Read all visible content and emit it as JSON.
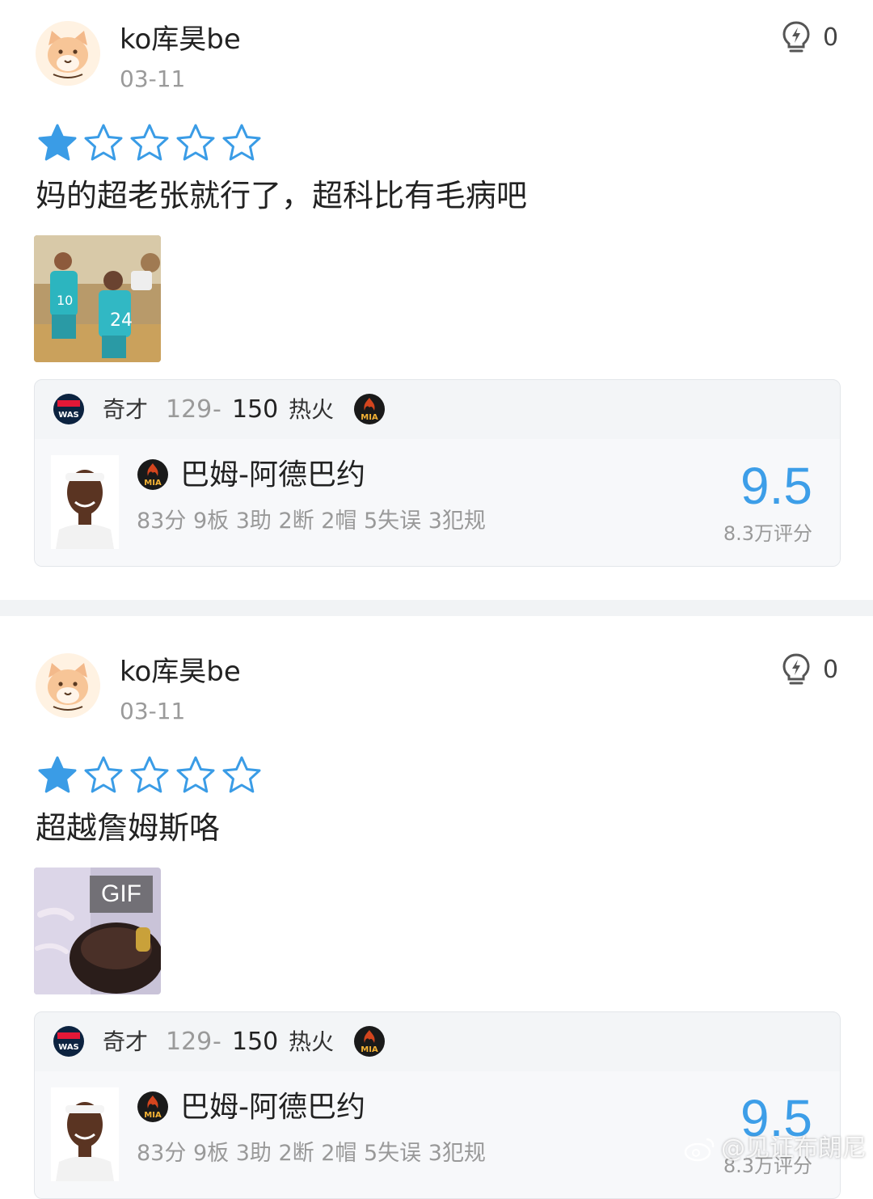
{
  "posts": [
    {
      "username": "ko库昊be",
      "date": "03-11",
      "like_count": "0",
      "rating_stars": 1,
      "rating_max": 5,
      "comment": "妈的超老张就行了，超科比有毛病吧",
      "media_type": "image",
      "card": {
        "home_team": "奇才",
        "home_score": "129",
        "score_separator": "-",
        "away_score": "150",
        "away_team": "热火",
        "home_logo_text": "WAS",
        "away_logo_text": "MIA",
        "player_name": "巴姆-阿德巴约",
        "player_stats": "83分 9板 3助 2断 2帽 5失误 3犯规",
        "rating": "9.5",
        "rating_count": "8.3万评分"
      }
    },
    {
      "username": "ko库昊be",
      "date": "03-11",
      "like_count": "0",
      "rating_stars": 1,
      "rating_max": 5,
      "comment": "超越詹姆斯咯",
      "media_type": "gif",
      "gif_label": "GIF",
      "card": {
        "home_team": "奇才",
        "home_score": "129",
        "score_separator": "-",
        "away_score": "150",
        "away_team": "热火",
        "home_logo_text": "WAS",
        "away_logo_text": "MIA",
        "player_name": "巴姆-阿德巴约",
        "player_stats": "83分 9板 3助 2断 2帽 5失误 3犯规",
        "rating": "9.5",
        "rating_count": "8.3万评分"
      }
    }
  ],
  "watermark": "@见证布朗尼",
  "colors": {
    "accent_blue": "#3d9ee8",
    "star_blue": "#3a9ce6",
    "muted_text": "#999999",
    "card_bg": "#f3f5f7"
  },
  "icons": {
    "like": "lightning-bulb-icon",
    "star_filled": "star-filled-icon",
    "star_empty": "star-outline-icon"
  }
}
